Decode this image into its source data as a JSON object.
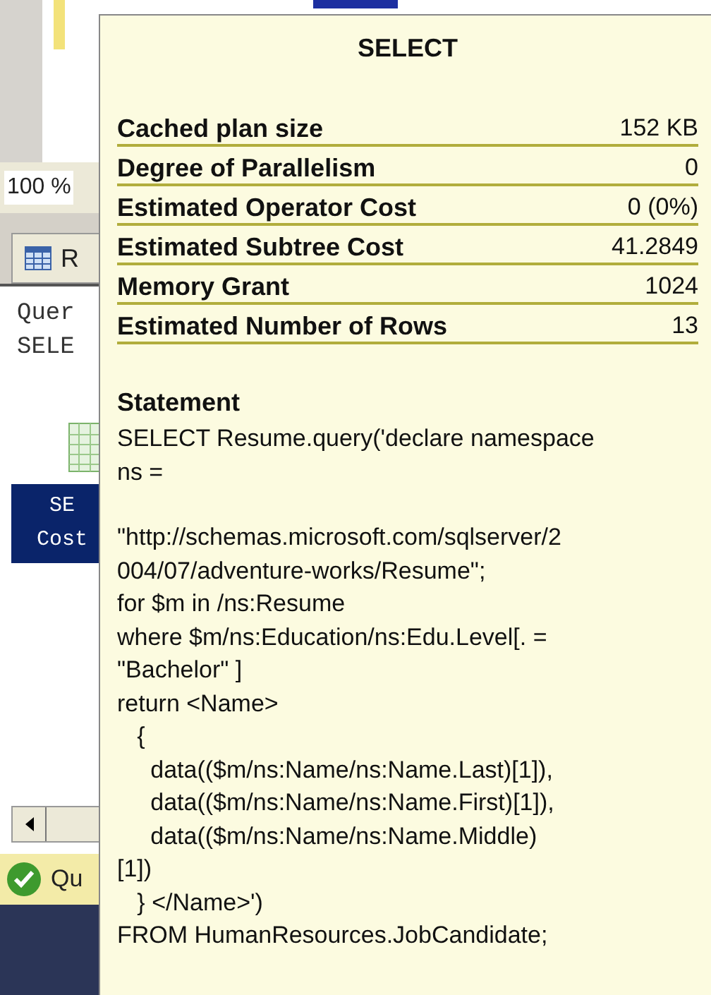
{
  "background": {
    "zoom": "100 %",
    "results_tab": "R",
    "query_lines": [
      "Quer",
      "SELE"
    ],
    "plan_node_lines": [
      "SE",
      "Cost"
    ],
    "status": "Qu"
  },
  "tooltip": {
    "title": "SELECT",
    "properties": [
      {
        "label": "Cached plan size",
        "value": "152 KB"
      },
      {
        "label": "Degree of Parallelism",
        "value": "0"
      },
      {
        "label": "Estimated Operator Cost",
        "value": "0 (0%)"
      },
      {
        "label": "Estimated Subtree Cost",
        "value": "41.2849"
      },
      {
        "label": "Memory Grant",
        "value": "1024"
      },
      {
        "label": "Estimated Number of Rows",
        "value": "13"
      }
    ],
    "statement": {
      "heading": "Statement",
      "paragraphs": [
        [
          "SELECT Resume.query('declare namespace",
          "ns ="
        ],
        [
          "\"http://schemas.microsoft.com/sqlserver/2",
          "004/07/adventure-works/Resume\";",
          "for $m in /ns:Resume",
          "where $m/ns:Education/ns:Edu.Level[. =",
          "\"Bachelor\" ]",
          "return <Name>",
          "   {",
          "     data(($m/ns:Name/ns:Name.Last)[1]),",
          "     data(($m/ns:Name/ns:Name.First)[1]),",
          "     data(($m/ns:Name/ns:Name.Middle)",
          "[1])",
          "   } </Name>')",
          "FROM HumanResources.JobCandidate;"
        ]
      ]
    }
  }
}
